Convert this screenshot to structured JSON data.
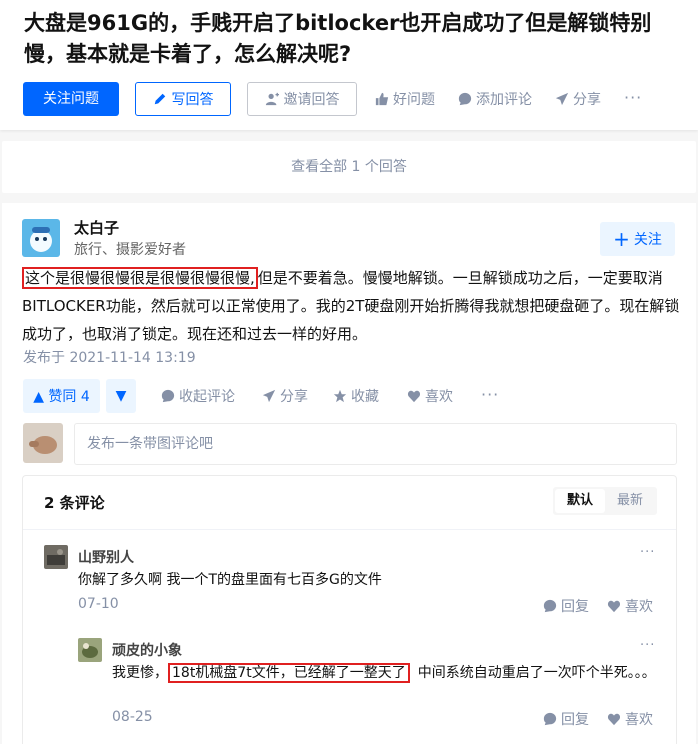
{
  "question": {
    "title": "大盘是961G的，手贱开启了bitlocker也开启成功了但是解锁特别慢，基本就是卡着了，怎么解决呢?",
    "follow_label": "关注问题",
    "write_answer_label": "写回答",
    "invite_label": "邀请回答",
    "good_question_label": "好问题",
    "add_comment_label": "添加评论",
    "share_label": "分享",
    "more": "···"
  },
  "view_all": {
    "label": "查看全部 1 个回答"
  },
  "answer": {
    "author": "太白子",
    "headline": "旅行、摄影爱好者",
    "follow_label": "关注",
    "content_highlight": "这个是很慢很慢很是很慢很慢很慢,",
    "content_rest": "但是不要着急。慢慢地解锁。一旦解锁成功之后，一定要取消BITLOCKER功能，然后就可以正常使用了。我的2T硬盘刚开始折腾得我就想把硬盘砸了。现在解锁成功了，也取消了锁定。现在还和过去一样的好用。",
    "published": "发布于 2021-11-14 13:19",
    "vote_label": "▲ 赞同 4",
    "vote_down": "▼",
    "collapse_comments": "收起评论",
    "share": "分享",
    "favorite": "收藏",
    "like": "喜欢",
    "more": "···",
    "comment_placeholder": "发布一条带图评论吧"
  },
  "comments": {
    "title": "2 条评论",
    "sort_default": "默认",
    "sort_latest": "最新",
    "items": [
      {
        "name": "山野别人",
        "text": "你解了多久啊 我一个T的盘里面有七百多G的文件",
        "date": "07-10",
        "reply": "回复",
        "like": "喜欢"
      },
      {
        "name": "顽皮的小象",
        "text_before": "我更惨，",
        "text_highlight": "18t机械盘7t文件，已经解了一整天了",
        "text_after": "中间系统自动重启了一次吓个半死。。。",
        "date": "08-25",
        "reply": "回复",
        "like": "喜欢"
      }
    ]
  },
  "colors": {
    "brand": "#0066ff",
    "highlight_box": "#e02020",
    "muted": "#8590a6"
  }
}
